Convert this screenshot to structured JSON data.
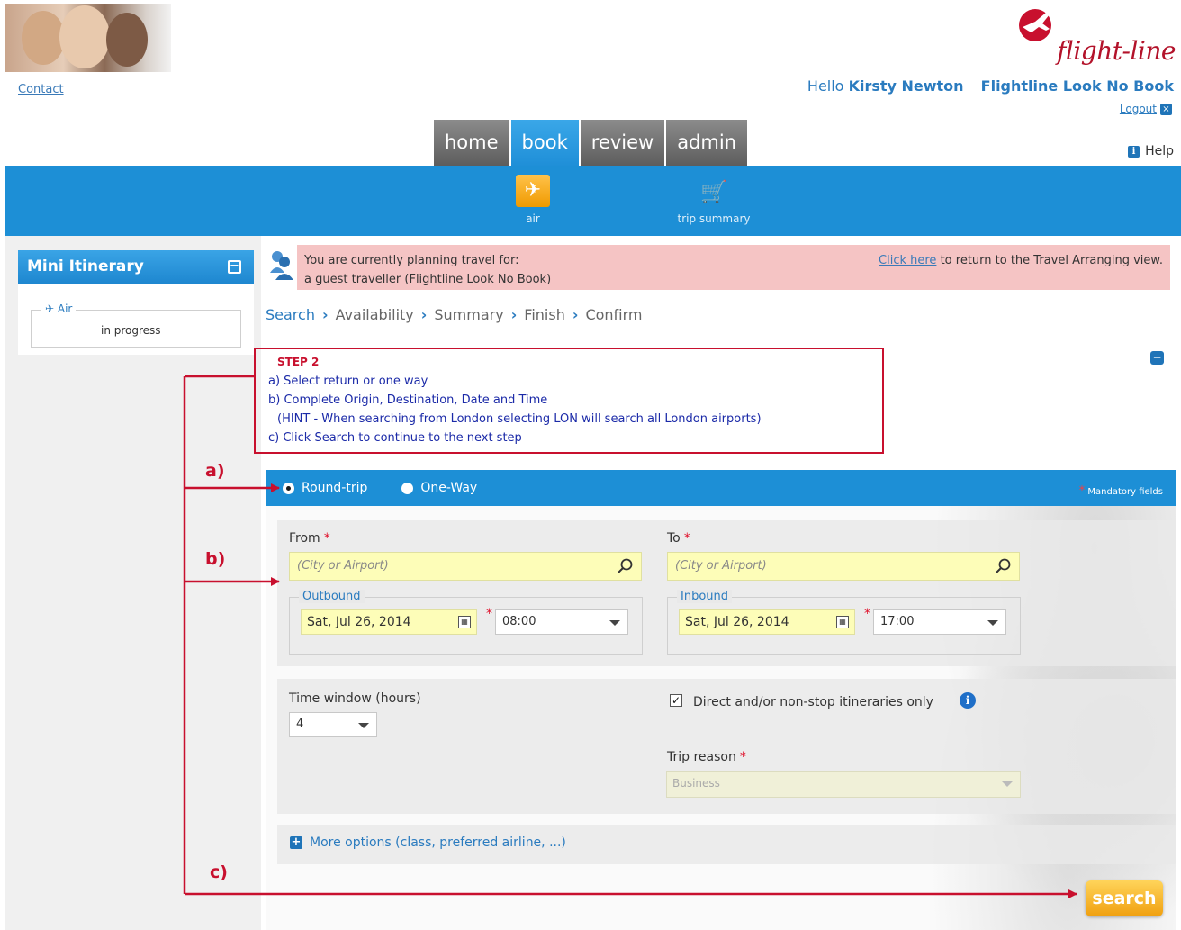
{
  "header": {
    "logo_text": "flight-line",
    "contact_link": "Contact",
    "greeting_prefix": "Hello",
    "user_name": "Kirsty Newton",
    "company": "Flightline Look No Book",
    "logout_label": "Logout",
    "help_label": "Help"
  },
  "tabs": [
    {
      "label": "home",
      "active": false
    },
    {
      "label": "book",
      "active": true
    },
    {
      "label": "review",
      "active": false
    },
    {
      "label": "admin",
      "active": false
    }
  ],
  "subnav": {
    "air_label": "air",
    "trip_summary_label": "trip summary"
  },
  "mini_itinerary": {
    "title": "Mini Itinerary",
    "air_label": "Air",
    "status": "in progress"
  },
  "guest_notice": {
    "line1": "You are currently planning travel for:",
    "line2": "a guest traveller  (Flightline Look No Book)",
    "link_text": "Click  here",
    "link_suffix": "to return to the Travel Arranging view."
  },
  "breadcrumb": [
    "Search",
    "Availability",
    "Summary",
    "Finish",
    "Confirm"
  ],
  "instructions": {
    "title": "STEP 2",
    "a": "a)  Select return or one way",
    "b": "b)  Complete Origin, Destination, Date and Time",
    "hint": "(HINT - When searching from London selecting LON will search all London airports)",
    "c": "c)  Click Search to continue to the next step"
  },
  "trip_type": {
    "round_trip": "Round-trip",
    "one_way": "One-Way",
    "selected": "Round-trip",
    "mandatory_note": "Mandatory fields"
  },
  "form": {
    "from_label": "From",
    "to_label": "To",
    "city_placeholder": "(City or Airport)",
    "outbound_legend": "Outbound",
    "inbound_legend": "Inbound",
    "outbound_date": "Sat, Jul 26, 2014",
    "outbound_time": "08:00",
    "inbound_date": "Sat, Jul 26, 2014",
    "inbound_time": "17:00",
    "time_window_label": "Time window (hours)",
    "time_window_value": "4",
    "direct_label": "Direct and/or non-stop itineraries only",
    "direct_checked": true,
    "trip_reason_label": "Trip reason",
    "trip_reason_value": "Business",
    "more_options": "More options (class, preferred airline, ...)",
    "search_button": "search"
  },
  "annotations": {
    "a": "a)",
    "b": "b)",
    "c": "c)"
  },
  "colors": {
    "brand_blue": "#1d8fd6",
    "annotation_red": "#c8102e",
    "input_yellow": "#fdfdb8",
    "search_orange": "#f0a010"
  }
}
